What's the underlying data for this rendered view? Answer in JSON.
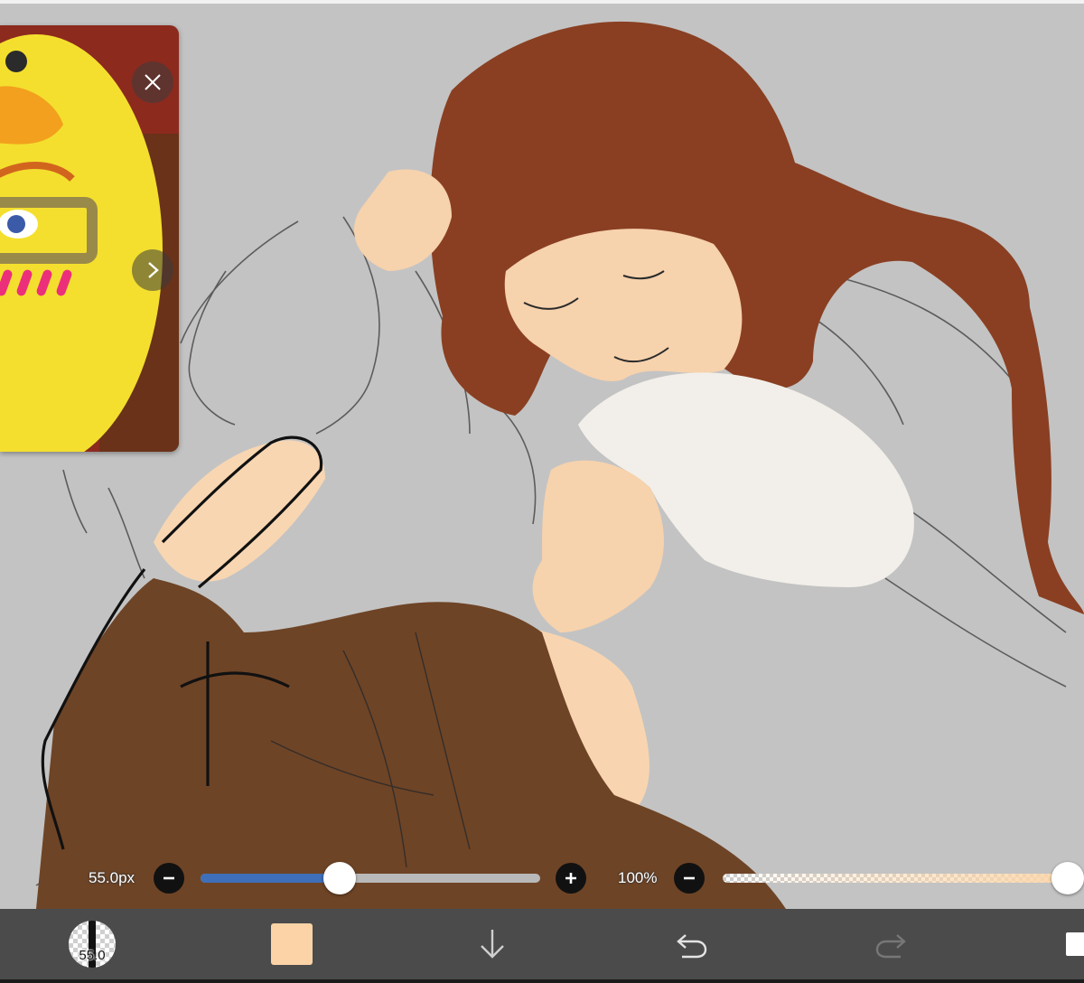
{
  "brush": {
    "size_label": "55.0px",
    "size_fraction": 0.41,
    "size_value_badge": "55.0"
  },
  "opacity": {
    "label": "100%",
    "value_fraction": 1.0
  },
  "colors": {
    "canvas_bg": "#c3c3c3",
    "slider_fill": "#3e6fb8",
    "current_color": "#fbd3a6",
    "toolbar_bg": "#4b4b4b"
  },
  "icons": {
    "close": "close-icon",
    "next": "chevron-right-icon",
    "minus": "minus-icon",
    "plus": "plus-icon",
    "down": "arrow-down-icon",
    "undo": "undo-icon",
    "redo": "redo-icon",
    "layer": "layer-icon"
  }
}
